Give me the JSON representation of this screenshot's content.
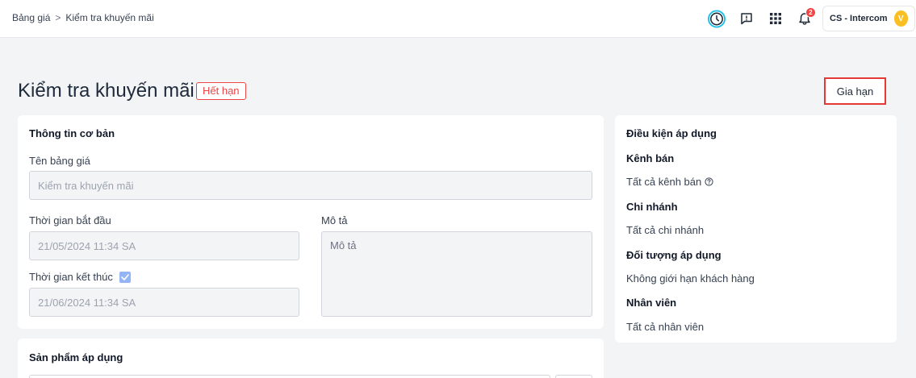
{
  "breadcrumb": {
    "parent": "Bảng giá",
    "separator": ">",
    "current": "Kiểm tra khuyến mãi"
  },
  "topbar": {
    "notification_count": "2",
    "account_name": "CS - Intercom",
    "avatar_letter": "V"
  },
  "header": {
    "title": "Kiểm tra khuyến mãi",
    "status": "Hết hạn",
    "renew_label": "Gia hạn"
  },
  "basic_info": {
    "title": "Thông tin cơ bản",
    "name_label": "Tên bảng giá",
    "name_value": "Kiểm tra khuyến mãi",
    "start_label": "Thời gian bắt đầu",
    "start_value": "21/05/2024 11:34 SA",
    "end_label": "Thời gian kết thúc",
    "end_value": "21/06/2024 11:34 SA",
    "desc_label": "Mô tả",
    "desc_placeholder": "Mô tả"
  },
  "products": {
    "title": "Sản phẩm áp dụng"
  },
  "conditions": {
    "title": "Điều kiện áp dụng",
    "channel_heading": "Kênh bán",
    "channel_value": "Tất cả kênh bán",
    "branch_heading": "Chi nhánh",
    "branch_value": "Tất cả chi nhánh",
    "target_heading": "Đối tượng áp dụng",
    "target_value": "Không giới hạn khách hàng",
    "staff_heading": "Nhân viên",
    "staff_value": "Tất cả nhân viên"
  },
  "colors": {
    "accent_red": "#ef4444",
    "checkbox_blue": "#93b4f5",
    "avatar_yellow": "#fbbf24"
  }
}
